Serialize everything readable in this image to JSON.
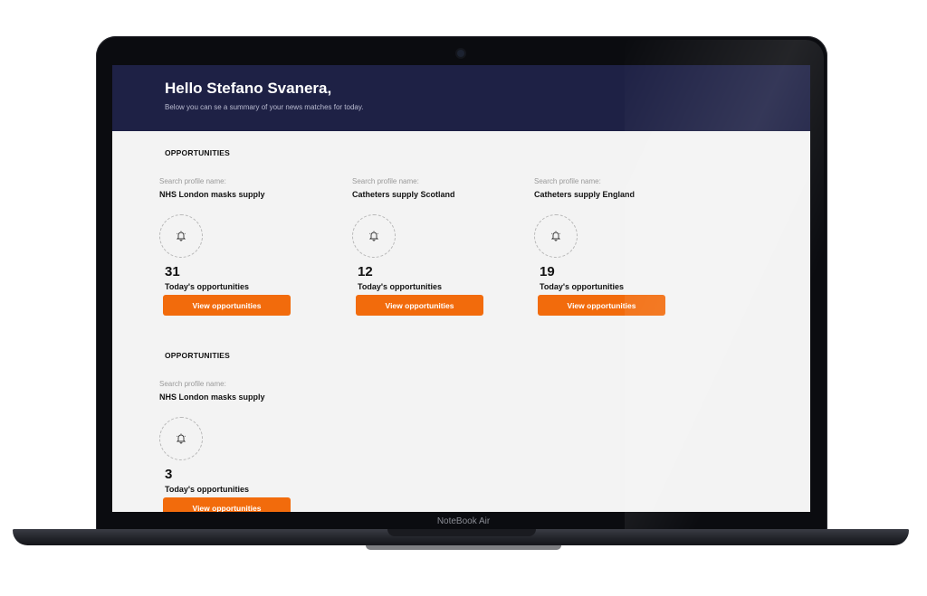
{
  "device": {
    "brand_label": "NoteBook Air"
  },
  "header": {
    "greeting": "Hello Stefano Svanera,",
    "subtitle": "Below you can se a summary of your news matches for today."
  },
  "sections": [
    {
      "title": "OPPORTUNITIES",
      "cards": [
        {
          "label": "Search profile name:",
          "profile": "NHS London masks supply",
          "count": "31",
          "count_label": "Today's opportunities",
          "button": "View opportunities",
          "icon": "bell-icon"
        },
        {
          "label": "Search profile name:",
          "profile": "Catheters supply Scotland",
          "count": "12",
          "count_label": "Today's opportunities",
          "button": "View opportunities",
          "icon": "bell-icon"
        },
        {
          "label": "Search profile name:",
          "profile": "Catheters supply England",
          "count": "19",
          "count_label": "Today's opportunities",
          "button": "View opportunities",
          "icon": "bell-icon"
        }
      ]
    },
    {
      "title": "OPPORTUNITIES",
      "cards": [
        {
          "label": "Search profile name:",
          "profile": "NHS London masks supply",
          "count": "3",
          "count_label": "Today's opportunities",
          "button": "View opportunities",
          "icon": "bell-icon"
        }
      ]
    }
  ],
  "colors": {
    "header_bg": "#1e2145",
    "accent": "#f26b0c",
    "page_bg": "#f3f3f3"
  }
}
